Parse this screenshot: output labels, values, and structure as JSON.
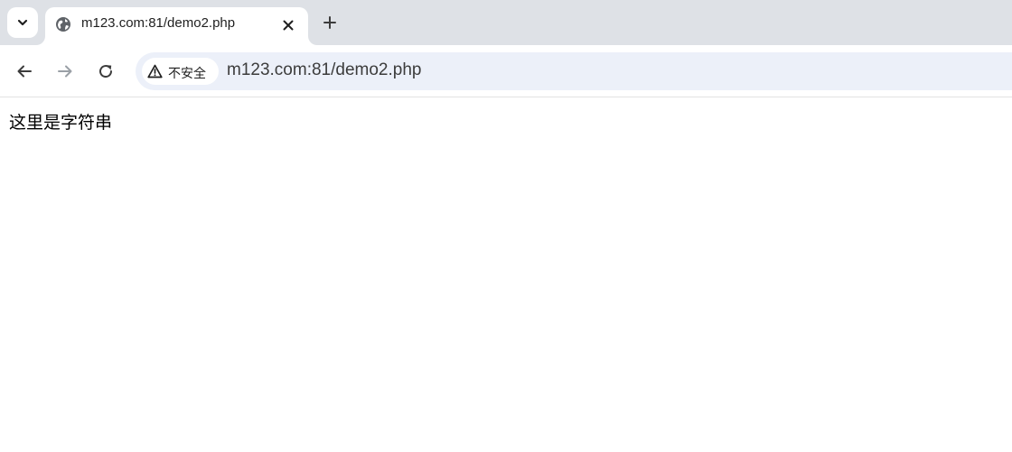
{
  "browser": {
    "tab": {
      "title": "m123.com:81/demo2.php",
      "favicon": "globe-icon"
    },
    "icons": {
      "tab_search": "chevron-down-icon",
      "tab_close": "close-icon",
      "new_tab": "plus-icon",
      "back": "arrow-left-icon",
      "forward": "arrow-right-icon",
      "reload": "reload-icon",
      "security": "warning-triangle-icon"
    },
    "omnibox": {
      "security_label": "不安全",
      "url": "m123.com:81/demo2.php"
    },
    "colors": {
      "tabstrip_bg": "#dee1e6",
      "omnibox_bg": "#ecf0f9",
      "forward_disabled": "#9aa0a6"
    }
  },
  "page": {
    "body_text": "这里是字符串"
  }
}
